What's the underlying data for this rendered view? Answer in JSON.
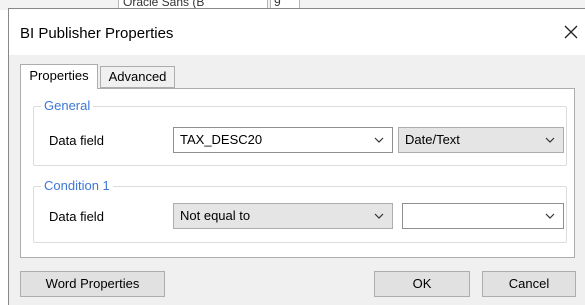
{
  "background": {
    "font_box": "Oracle Sans (B",
    "size_box": "9"
  },
  "dialog": {
    "title": "BI Publisher Properties",
    "tabs": [
      {
        "label": "Properties"
      },
      {
        "label": "Advanced"
      }
    ],
    "general": {
      "legend": "General",
      "field_label": "Data field",
      "field_value": "TAX_DESC20",
      "type_value": "Date/Text"
    },
    "condition": {
      "legend": "Condition 1",
      "field_label": "Data field",
      "operator_value": "Not equal to",
      "compare_value": ""
    },
    "buttons": {
      "word_properties": "Word Properties",
      "ok": "OK",
      "cancel": "Cancel"
    }
  },
  "colors": {
    "legend": "#3c78d8",
    "dialog_bg": "#f0f0f0",
    "button_bg": "#e1e1e1"
  },
  "icons": {
    "close": "close-icon",
    "dropdown": "chevron-down-icon"
  }
}
